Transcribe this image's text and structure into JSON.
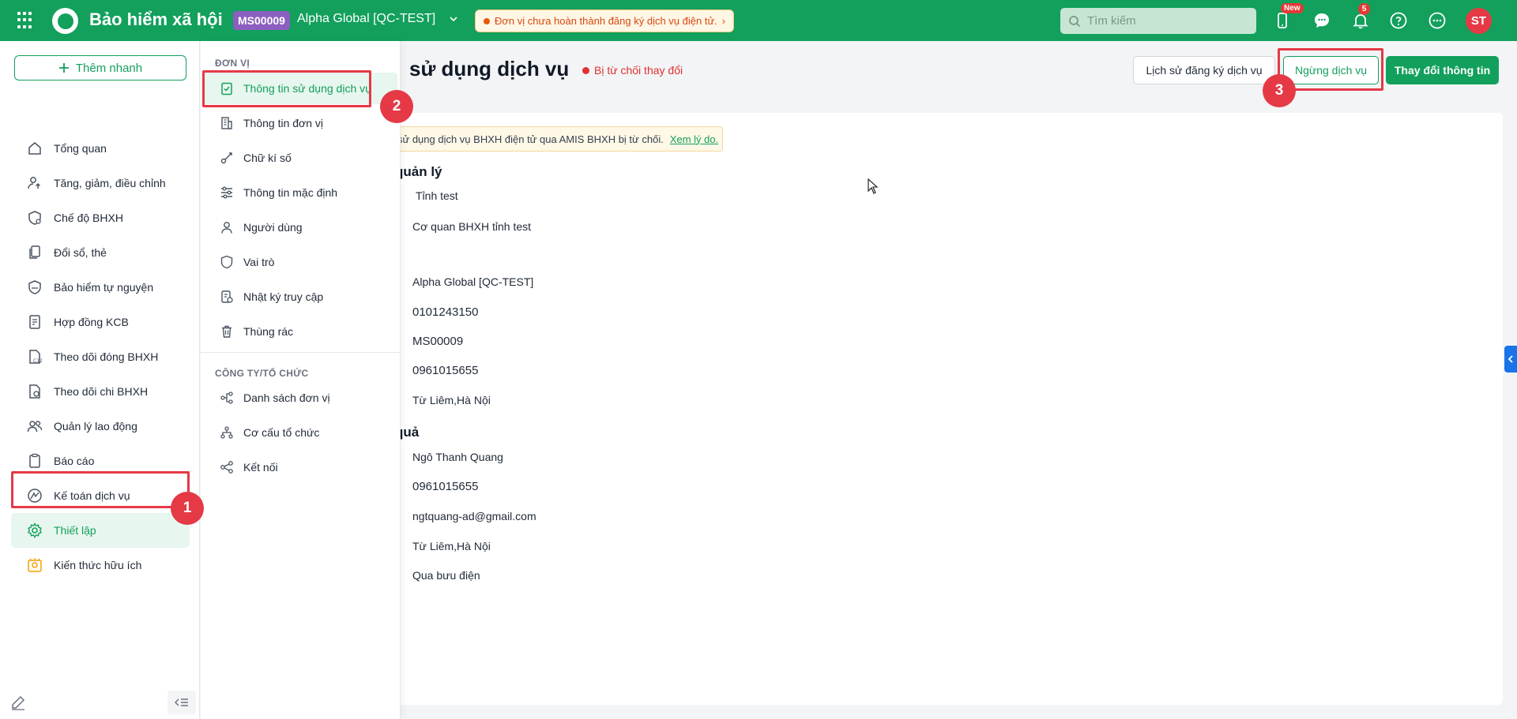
{
  "header": {
    "app_title": "Bảo hiểm xã hội",
    "unit_code": "MS00009",
    "unit_name": "Alpha Global [QC-TEST]",
    "alert_text": "Đơn vị chưa hoàn thành đăng ký dịch vụ điện tử.",
    "alert_chevron": "›",
    "search_placeholder": "Tìm kiếm",
    "new_badge": "New",
    "notification_count": "5",
    "avatar_initials": "ST",
    "colors": {
      "brand": "#12a05c",
      "danger": "#e53946"
    }
  },
  "sidebar": {
    "quick_add": "Thêm nhanh",
    "items": [
      {
        "label": "Tổng quan",
        "icon": "home-icon"
      },
      {
        "label": "Tăng, giảm, điều chỉnh",
        "icon": "user-arrow-icon"
      },
      {
        "label": "Chế độ BHXH",
        "icon": "heart-shield-icon"
      },
      {
        "label": "Đổi sổ, thẻ",
        "icon": "cards-icon"
      },
      {
        "label": "Bảo hiểm tự nguyện",
        "icon": "shield-icon"
      },
      {
        "label": "Hợp đồng KCB",
        "icon": "contract-icon"
      },
      {
        "label": "Theo dõi đóng BHXH",
        "icon": "doc-c12-icon"
      },
      {
        "label": "Theo dõi chi BHXH",
        "icon": "doc-money-icon"
      },
      {
        "label": "Quản lý lao động",
        "icon": "users-icon"
      },
      {
        "label": "Báo cáo",
        "icon": "clipboard-icon"
      },
      {
        "label": "Kế toán dịch vụ",
        "icon": "chart-circle-icon"
      },
      {
        "label": "Thiết lập",
        "icon": "gear-icon",
        "active": true
      },
      {
        "label": "Kiến thức hữu ích",
        "icon": "lightbulb-icon"
      }
    ]
  },
  "submenu": {
    "section1": "ĐƠN VỊ",
    "section2": "CÔNG TY/TỔ CHỨC",
    "items1": [
      {
        "label": "Thông tin sử dụng dịch vụ",
        "icon": "clipboard-check-icon",
        "active": true
      },
      {
        "label": "Thông tin đơn vị",
        "icon": "building-icon"
      },
      {
        "label": "Chữ kí số",
        "icon": "signature-icon"
      },
      {
        "label": "Thông tin mặc định",
        "icon": "sliders-icon"
      },
      {
        "label": "Người dùng",
        "icon": "user-icon"
      },
      {
        "label": "Vai trò",
        "icon": "shield-outline-icon"
      },
      {
        "label": "Nhật ký truy cập",
        "icon": "log-icon"
      },
      {
        "label": "Thùng rác",
        "icon": "trash-icon"
      }
    ],
    "items2": [
      {
        "label": "Danh sách đơn vị",
        "icon": "network-icon"
      },
      {
        "label": "Cơ cấu tổ chức",
        "icon": "org-chart-icon"
      },
      {
        "label": "Kết nối",
        "icon": "share-icon"
      }
    ]
  },
  "markers": [
    "1",
    "2",
    "3"
  ],
  "main": {
    "title": "sử dụng dịch vụ",
    "status": "Bị từ chối thay đổi",
    "btn_history": "Lịch sử đăng ký dịch vụ",
    "btn_stop": "Ngừng dịch vụ",
    "btn_change": "Thay đổi thông tin",
    "notice_text": "sử dụng dịch vụ BHXH điện tử qua AMIS BHXH bị từ chối.",
    "notice_link": "Xem lý do.",
    "section_manage": "quản lý",
    "section_result": "quả",
    "fields_manage": [
      "Tỉnh test",
      "Cơ quan BHXH tỉnh test"
    ],
    "fields_unit": [
      "Alpha Global [QC-TEST]",
      "0101243150",
      "MS00009",
      "0961015655",
      "Từ Liêm,Hà Nội"
    ],
    "fields_result": [
      "Ngô Thanh Quang",
      "0961015655",
      "ngtquang-ad@gmail.com",
      "Từ Liêm,Hà Nội",
      "Qua bưu điện"
    ]
  }
}
